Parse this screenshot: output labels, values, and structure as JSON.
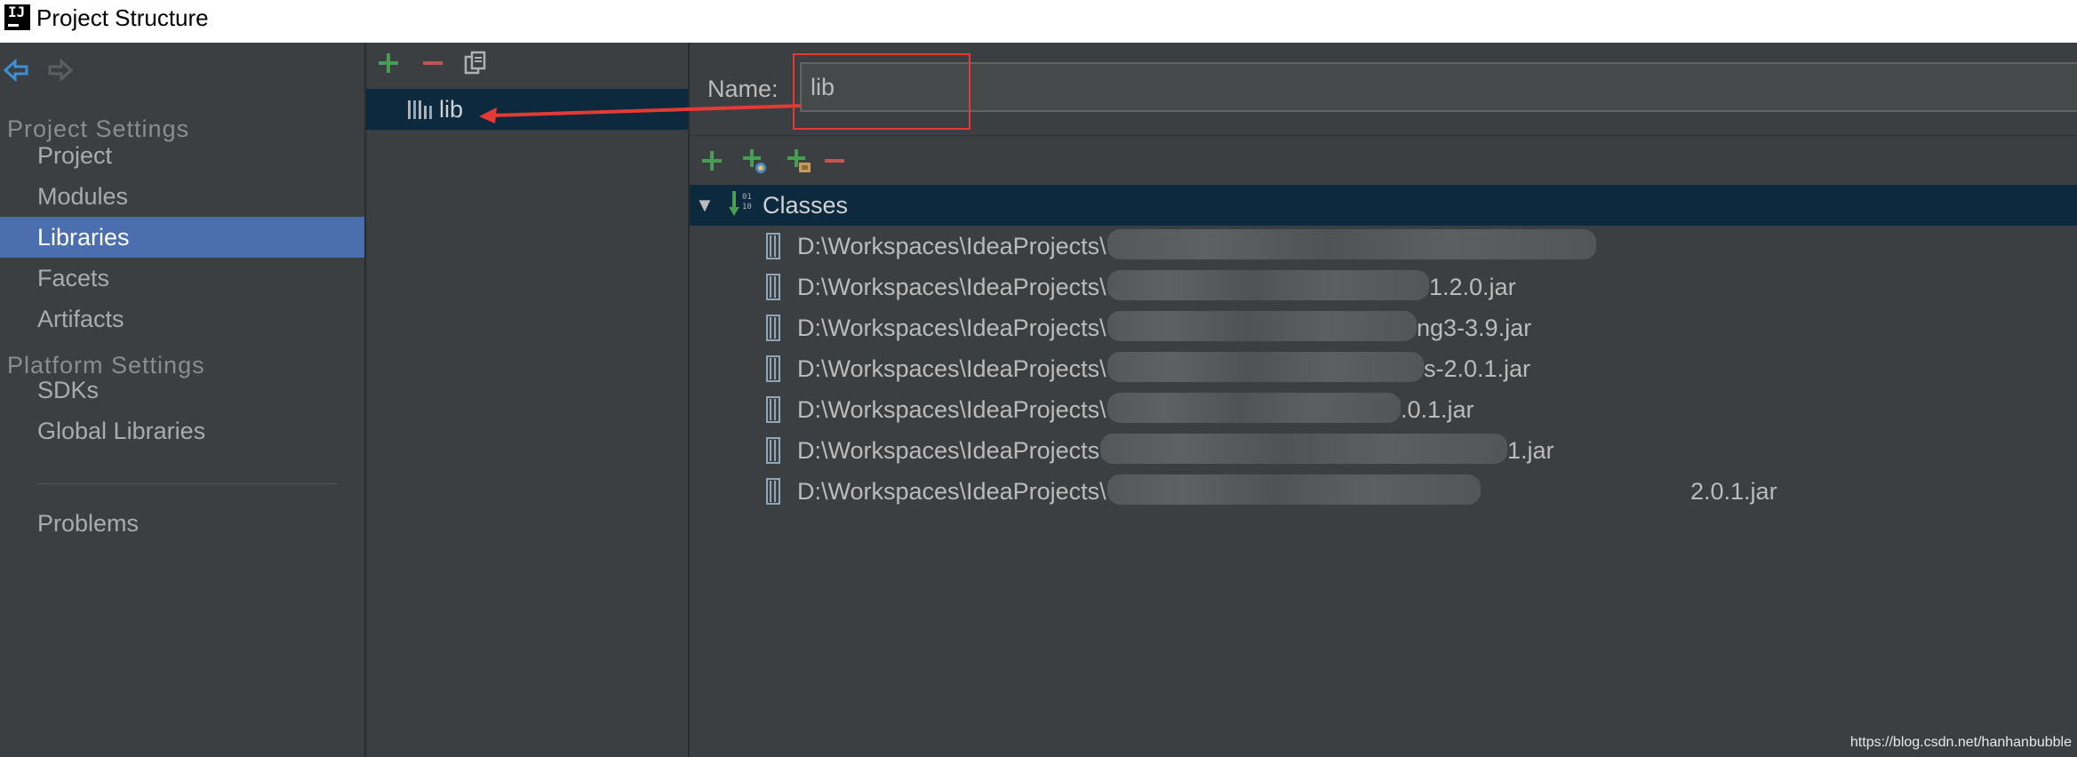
{
  "window": {
    "title": "Project Structure",
    "logo_text": "IJ"
  },
  "nav": {
    "project_settings_header": "Project Settings",
    "platform_settings_header": "Platform Settings",
    "items": [
      {
        "label": "Project"
      },
      {
        "label": "Modules"
      },
      {
        "label": "Libraries",
        "selected": true
      },
      {
        "label": "Facets"
      },
      {
        "label": "Artifacts"
      }
    ],
    "platform_items": [
      {
        "label": "SDKs"
      },
      {
        "label": "Global Libraries"
      }
    ],
    "problems_label": "Problems"
  },
  "library_list": {
    "items": [
      {
        "label": "lib",
        "selected": true
      }
    ]
  },
  "detail": {
    "name_label": "Name:",
    "name_value": "lib",
    "classes_label": "Classes",
    "jars": [
      {
        "prefix": "D:\\Workspaces\\IdeaProjects\\",
        "suffix": ""
      },
      {
        "prefix": "D:\\Workspaces\\IdeaProjects\\",
        "suffix": "1.2.0.jar"
      },
      {
        "prefix": "D:\\Workspaces\\IdeaProjects\\",
        "suffix": "ng3-3.9.jar"
      },
      {
        "prefix": "D:\\Workspaces\\IdeaProjects\\",
        "suffix": "s-2.0.1.jar"
      },
      {
        "prefix": "D:\\Workspaces\\IdeaProjects\\",
        "suffix": ".0.1.jar"
      },
      {
        "prefix": "D:\\Workspaces\\IdeaProjects",
        "suffix": "1.jar"
      },
      {
        "prefix": "D:\\Workspaces\\IdeaProjects\\",
        "suffix": "2.0.1.jar"
      }
    ]
  },
  "watermark": "https://blog.csdn.net/hanhanbubble",
  "colors": {
    "background": "#3c3f41",
    "selection": "#4b6eaf",
    "tree_selection": "#0d293e",
    "add_green": "#499c54",
    "remove_red": "#c75450",
    "annotation_red": "#e53935"
  }
}
